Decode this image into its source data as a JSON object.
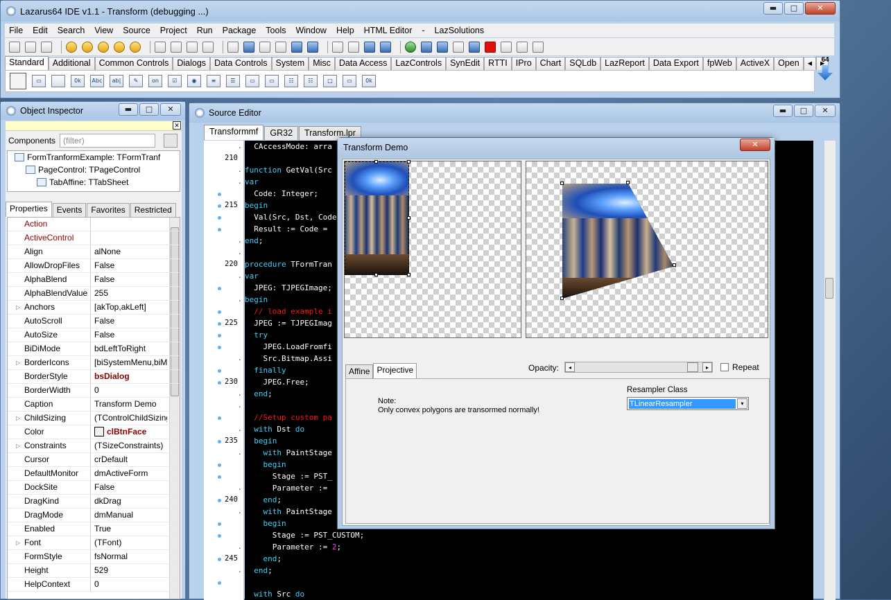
{
  "ide": {
    "title": "Lazarus64 IDE v1.1 - Transform (debugging ...)",
    "window_buttons": {
      "minimize": "▬",
      "maximize": "□",
      "close": "✕"
    },
    "menu": [
      "File",
      "Edit",
      "Search",
      "View",
      "Source",
      "Project",
      "Run",
      "Package",
      "Tools",
      "Window",
      "Help",
      "HTML Editor",
      "-",
      "LazSolutions"
    ],
    "palette_tabs": [
      "Standard",
      "Additional",
      "Common Controls",
      "Dialogs",
      "Data Controls",
      "System",
      "Misc",
      "Data Access",
      "LazControls",
      "SynEdit",
      "RTTI",
      "IPro",
      "Chart",
      "SQLdb",
      "LazReport",
      "Data Export",
      "fpWeb",
      "ActiveX",
      "Open"
    ],
    "palette_scroll": {
      "left": "◂",
      "right": "▸"
    },
    "palette_icons": [
      "",
      "▭",
      "",
      "0k",
      "Abc",
      "ab|",
      "✎",
      "on",
      "☑",
      "◉",
      "≡",
      "☰",
      "▭",
      "▭",
      "☷",
      "☷",
      "□",
      "▭",
      "0k"
    ],
    "arch_label": "64"
  },
  "object_inspector": {
    "title": "Object Inspector",
    "close_x": "✕",
    "components_label": "Components",
    "filter_placeholder": "(filter)",
    "tree": [
      "FormTranformExample: TFormTranf",
      "PageControl: TPageControl",
      "TabAffine: TTabSheet"
    ],
    "tabs": [
      "Properties",
      "Events",
      "Favorites",
      "Restricted"
    ],
    "properties": [
      {
        "name": "Action",
        "value": "",
        "expandable": false,
        "red": true
      },
      {
        "name": "ActiveControl",
        "value": "",
        "expandable": false,
        "red": true
      },
      {
        "name": "Align",
        "value": "alNone",
        "expandable": false
      },
      {
        "name": "AllowDropFiles",
        "value": "False",
        "expandable": false
      },
      {
        "name": "AlphaBlend",
        "value": "False",
        "expandable": false
      },
      {
        "name": "AlphaBlendValue",
        "value": "255",
        "expandable": false
      },
      {
        "name": "Anchors",
        "value": "[akTop,akLeft]",
        "expandable": true
      },
      {
        "name": "AutoScroll",
        "value": "False",
        "expandable": false
      },
      {
        "name": "AutoSize",
        "value": "False",
        "expandable": false
      },
      {
        "name": "BiDiMode",
        "value": "bdLeftToRight",
        "expandable": false
      },
      {
        "name": "BorderIcons",
        "value": "[biSystemMenu,biM",
        "expandable": true
      },
      {
        "name": "BorderStyle",
        "value": "bsDialog",
        "expandable": false,
        "bold": true
      },
      {
        "name": "BorderWidth",
        "value": "0",
        "expandable": false
      },
      {
        "name": "Caption",
        "value": "Transform Demo",
        "expandable": false
      },
      {
        "name": "ChildSizing",
        "value": "(TControlChildSizing",
        "expandable": true
      },
      {
        "name": "Color",
        "value": "clBtnFace",
        "expandable": false,
        "bold": true,
        "swatch": true
      },
      {
        "name": "Constraints",
        "value": "(TSizeConstraints)",
        "expandable": true
      },
      {
        "name": "Cursor",
        "value": "crDefault",
        "expandable": false
      },
      {
        "name": "DefaultMonitor",
        "value": "dmActiveForm",
        "expandable": false
      },
      {
        "name": "DockSite",
        "value": "False",
        "expandable": false
      },
      {
        "name": "DragKind",
        "value": "dkDrag",
        "expandable": false
      },
      {
        "name": "DragMode",
        "value": "dmManual",
        "expandable": false
      },
      {
        "name": "Enabled",
        "value": "True",
        "expandable": false
      },
      {
        "name": "Font",
        "value": "(TFont)",
        "expandable": true
      },
      {
        "name": "FormStyle",
        "value": "fsNormal",
        "expandable": false
      },
      {
        "name": "Height",
        "value": "529",
        "expandable": false
      },
      {
        "name": "HelpContext",
        "value": "0",
        "expandable": false
      }
    ]
  },
  "source_editor": {
    "title": "Source Editor",
    "tabs": [
      "Transformmf",
      "GR32",
      "Transform.lpr"
    ],
    "gutter": [
      {
        "n": ".",
        "dot": false
      },
      {
        "n": "210",
        "dot": false
      },
      {
        "n": ".",
        "dot": false
      },
      {
        "n": ".",
        "dot": false
      },
      {
        "n": "",
        "dot": true
      },
      {
        "n": "215",
        "dot": true
      },
      {
        "n": "",
        "dot": true
      },
      {
        "n": "",
        "dot": true
      },
      {
        "n": ".",
        "dot": false
      },
      {
        "n": ".",
        "dot": false
      },
      {
        "n": "220",
        "dot": false
      },
      {
        "n": ".",
        "dot": false
      },
      {
        "n": "",
        "dot": true
      },
      {
        "n": ".",
        "dot": false
      },
      {
        "n": "",
        "dot": true
      },
      {
        "n": "225",
        "dot": true
      },
      {
        "n": "",
        "dot": true
      },
      {
        "n": "",
        "dot": true
      },
      {
        "n": ".",
        "dot": false
      },
      {
        "n": "",
        "dot": true
      },
      {
        "n": "230",
        "dot": true
      },
      {
        "n": ".",
        "dot": false
      },
      {
        "n": ".",
        "dot": false
      },
      {
        "n": "",
        "dot": true
      },
      {
        "n": ".",
        "dot": false
      },
      {
        "n": "235",
        "dot": true
      },
      {
        "n": ".",
        "dot": false
      },
      {
        "n": "",
        "dot": true
      },
      {
        "n": "",
        "dot": true
      },
      {
        "n": ".",
        "dot": false
      },
      {
        "n": "240",
        "dot": true
      },
      {
        "n": ".",
        "dot": false
      },
      {
        "n": "",
        "dot": true
      },
      {
        "n": "",
        "dot": true
      },
      {
        "n": ".",
        "dot": false
      },
      {
        "n": "245",
        "dot": true
      },
      {
        "n": ".",
        "dot": false
      },
      {
        "n": "",
        "dot": true
      }
    ],
    "code_lines": [
      [
        {
          "t": "  CAccessMode: arra",
          "c": ""
        }
      ],
      [
        {
          "t": "",
          "c": ""
        }
      ],
      [
        {
          "t": "function",
          "c": "kw"
        },
        {
          "t": " GetVal(Src",
          "c": ""
        }
      ],
      [
        {
          "t": "var",
          "c": "kw"
        }
      ],
      [
        {
          "t": "  Code: Integer;",
          "c": ""
        }
      ],
      [
        {
          "t": "begin",
          "c": "kw"
        }
      ],
      [
        {
          "t": "  Val(Src, Dst, Code",
          "c": ""
        }
      ],
      [
        {
          "t": "  Result := Code = ",
          "c": ""
        }
      ],
      [
        {
          "t": "end",
          "c": "kw"
        },
        {
          "t": ";",
          "c": ""
        }
      ],
      [
        {
          "t": "",
          "c": ""
        }
      ],
      [
        {
          "t": "procedure",
          "c": "kw"
        },
        {
          "t": " TFormTran",
          "c": ""
        }
      ],
      [
        {
          "t": "var",
          "c": "kw"
        }
      ],
      [
        {
          "t": "  JPEG: TJPEGImage;",
          "c": ""
        }
      ],
      [
        {
          "t": "begin",
          "c": "kw"
        }
      ],
      [
        {
          "t": "  // load example i",
          "c": "cm"
        }
      ],
      [
        {
          "t": "  JPEG := TJPEGImag",
          "c": ""
        }
      ],
      [
        {
          "t": "  try",
          "c": "kw"
        }
      ],
      [
        {
          "t": "    JPEG.LoadFromfi",
          "c": ""
        }
      ],
      [
        {
          "t": "    Src.Bitmap.Assi",
          "c": ""
        }
      ],
      [
        {
          "t": "  finally",
          "c": "kw"
        }
      ],
      [
        {
          "t": "    JPEG.Free;",
          "c": ""
        }
      ],
      [
        {
          "t": "  end",
          "c": "kw"
        },
        {
          "t": ";",
          "c": ""
        }
      ],
      [
        {
          "t": "",
          "c": ""
        }
      ],
      [
        {
          "t": "  //Setup custom pa",
          "c": "cm"
        }
      ],
      [
        {
          "t": "  with",
          "c": "kw"
        },
        {
          "t": " Dst ",
          "c": ""
        },
        {
          "t": "do",
          "c": "kw"
        }
      ],
      [
        {
          "t": "  begin",
          "c": "kw"
        }
      ],
      [
        {
          "t": "    with",
          "c": "kw"
        },
        {
          "t": " PaintStage",
          "c": ""
        }
      ],
      [
        {
          "t": "    begin",
          "c": "kw"
        }
      ],
      [
        {
          "t": "      Stage := PST_",
          "c": ""
        }
      ],
      [
        {
          "t": "      Parameter := ",
          "c": ""
        }
      ],
      [
        {
          "t": "    end",
          "c": "kw"
        },
        {
          "t": ";",
          "c": ""
        }
      ],
      [
        {
          "t": "    with",
          "c": "kw"
        },
        {
          "t": " PaintStage",
          "c": ""
        }
      ],
      [
        {
          "t": "    begin",
          "c": "kw"
        }
      ],
      [
        {
          "t": "      Stage := PST_CUSTOM;",
          "c": ""
        }
      ],
      [
        {
          "t": "      Parameter := ",
          "c": ""
        },
        {
          "t": "2",
          "c": "num"
        },
        {
          "t": ";",
          "c": ""
        }
      ],
      [
        {
          "t": "    end",
          "c": "kw"
        },
        {
          "t": ";",
          "c": ""
        }
      ],
      [
        {
          "t": "  end",
          "c": "kw"
        },
        {
          "t": ";",
          "c": ""
        }
      ],
      [
        {
          "t": "",
          "c": ""
        }
      ],
      [
        {
          "t": "  with",
          "c": "kw"
        },
        {
          "t": " Src ",
          "c": ""
        },
        {
          "t": "do",
          "c": "kw"
        }
      ]
    ]
  },
  "demo_dialog": {
    "title": "Transform Demo",
    "close_x": "✕",
    "tabs": [
      "Affine",
      "Projective"
    ],
    "active_tab": "Projective",
    "opacity_label": "Opacity:",
    "opacity_value": 0.95,
    "repeat_label": "Repeat",
    "repeat_checked": false,
    "note_title": "Note:",
    "note_text": "Only convex polygons are transormed normally!",
    "resampler_label": "Resampler Class",
    "resampler_value": "TLinearResampler",
    "scroll_arrows": {
      "left": "◂",
      "right": "▸",
      "down": "▾"
    }
  }
}
